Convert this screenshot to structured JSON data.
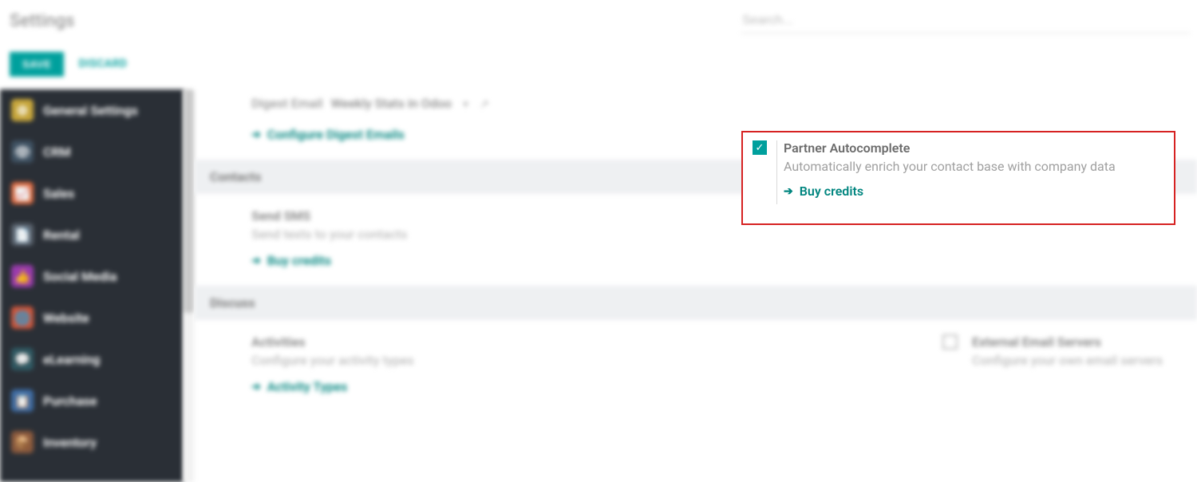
{
  "header": {
    "title": "Settings",
    "search_placeholder": "Search...",
    "save": "SAVE",
    "discard": "DISCARD"
  },
  "sidebar": [
    "General Settings",
    "CRM",
    "Sales",
    "Rental",
    "Social Media",
    "Website",
    "eLearning",
    "Purchase",
    "Inventory"
  ],
  "digest": {
    "label": "Digest Email",
    "value": "Weekly Stats in Odoo",
    "configure": "Configure Digest Emails"
  },
  "sections": {
    "contacts": "Contacts",
    "discuss": "Discuss"
  },
  "contacts": {
    "sms": {
      "title": "Send SMS",
      "sub": "Send texts to your contacts",
      "link": "Buy credits"
    },
    "pa": {
      "title": "Partner Autocomplete",
      "sub": "Automatically enrich your contact base with company data",
      "link": "Buy credits"
    }
  },
  "discuss": {
    "act": {
      "title": "Activities",
      "sub": "Configure your activity types",
      "link": "Activity Types"
    },
    "ext": {
      "title": "External Email Servers",
      "sub": "Configure your own email servers"
    }
  }
}
